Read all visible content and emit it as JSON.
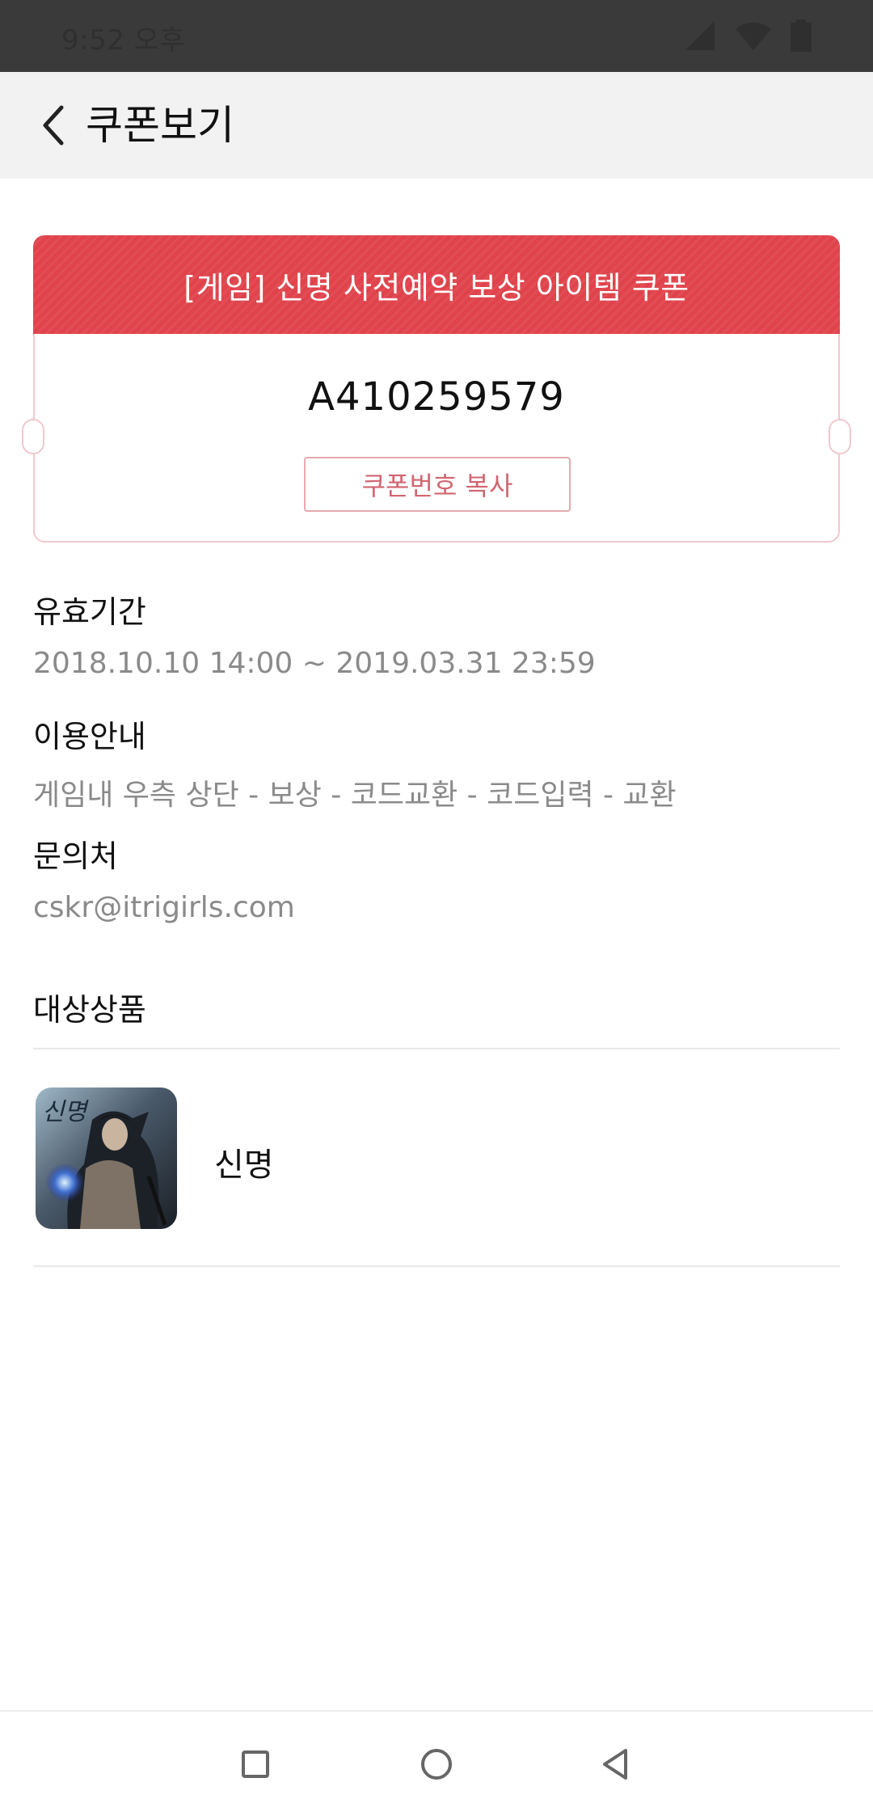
{
  "status_bar": {
    "time": "9:52 오후",
    "icons": [
      "signal-icon",
      "wifi-icon",
      "battery-icon"
    ]
  },
  "app_bar": {
    "back_icon": "chevron-left-icon",
    "title": "쿠폰보기"
  },
  "coupon": {
    "title": "[게임] 신명 사전예약 보상 아이템 쿠폰",
    "code": "A410259579",
    "copy_label": "쿠폰번호 복사",
    "accent_color": "#e0434b"
  },
  "validity": {
    "label": "유효기간",
    "value": "2018.10.10 14:00 ~ 2019.03.31 23:59"
  },
  "usage": {
    "label": "이용안내",
    "value": "게임내 우측 상단 - 보상 - 코드교환 - 코드입력 - 교환"
  },
  "contact": {
    "label": "문의처",
    "value": "cskr@itrigirls.com"
  },
  "target_products": {
    "label": "대상상품",
    "items": [
      {
        "name": "신명",
        "thumbnail_logo": "신명"
      }
    ]
  },
  "nav_bar": {
    "icons": [
      "recent-apps-icon",
      "home-icon",
      "back-triangle-icon"
    ]
  }
}
